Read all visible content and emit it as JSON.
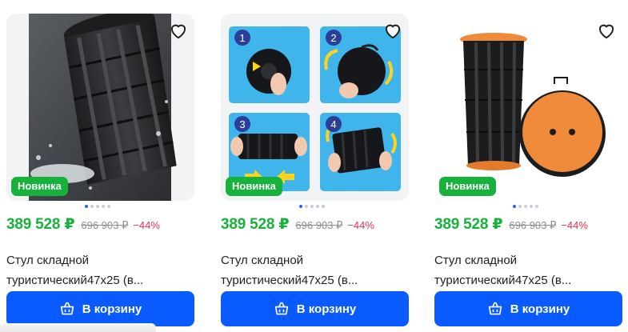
{
  "products": [
    {
      "badge": "Новинка",
      "price": "389 528 ₽",
      "old_price": "696 903 ₽",
      "discount": "−44%",
      "title_line1": "Стул складной",
      "title_line2": "туристический47х25 (в...",
      "cart_label": "В корзину",
      "image_desc": "stool-splash-photo",
      "active_dot": 0
    },
    {
      "badge": "Новинка",
      "price": "389 528 ₽",
      "old_price": "696 903 ₽",
      "discount": "−44%",
      "title_line1": "Стул складной",
      "title_line2": "туристический47х25 (в...",
      "cart_label": "В корзину",
      "image_desc": "stool-instruction-steps",
      "steps": [
        "1",
        "2",
        "3",
        "4"
      ],
      "active_dot": 0
    },
    {
      "badge": "Новинка",
      "price": "389 528 ₽",
      "old_price": "696 903 ₽",
      "discount": "−44%",
      "title_line1": "Стул складной",
      "title_line2": "туристический47х25 (в...",
      "cart_label": "В корзину",
      "image_desc": "orange-stool-product",
      "active_dot": 0
    }
  ],
  "colors": {
    "accent": "#0a5bff",
    "price_green": "#16b23b",
    "discount_red": "#e8344e",
    "badge_green": "#16b23b"
  },
  "icons": [
    "heart-icon",
    "cart-icon"
  ]
}
